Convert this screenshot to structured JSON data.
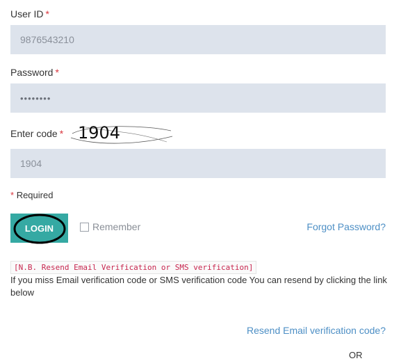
{
  "form": {
    "user_id": {
      "label": "User ID",
      "required_mark": "*",
      "value": "9876543210"
    },
    "password": {
      "label": "Password",
      "required_mark": "*",
      "value": "••••••••"
    },
    "code": {
      "label": "Enter code",
      "required_mark": "*",
      "captcha_text": "1904",
      "value": "1904"
    },
    "required_note": {
      "mark": "*",
      "text": "Required"
    },
    "login_label": "LOGIN",
    "remember_label": "Remember",
    "remember_checked": false,
    "forgot_password": "Forgot Password?"
  },
  "notice": {
    "code_text": "[N.B. Resend Email Verification or SMS verification]",
    "body": "If you miss Email verification code or SMS verification code You can resend by clicking the link below"
  },
  "resend_email_link": "Resend Email verification code?",
  "or_text": "OR",
  "colors": {
    "accent_teal": "#35a9a3",
    "link_blue": "#4d8fc5",
    "required_red": "#d9363e",
    "field_bg": "#dde3ec"
  }
}
